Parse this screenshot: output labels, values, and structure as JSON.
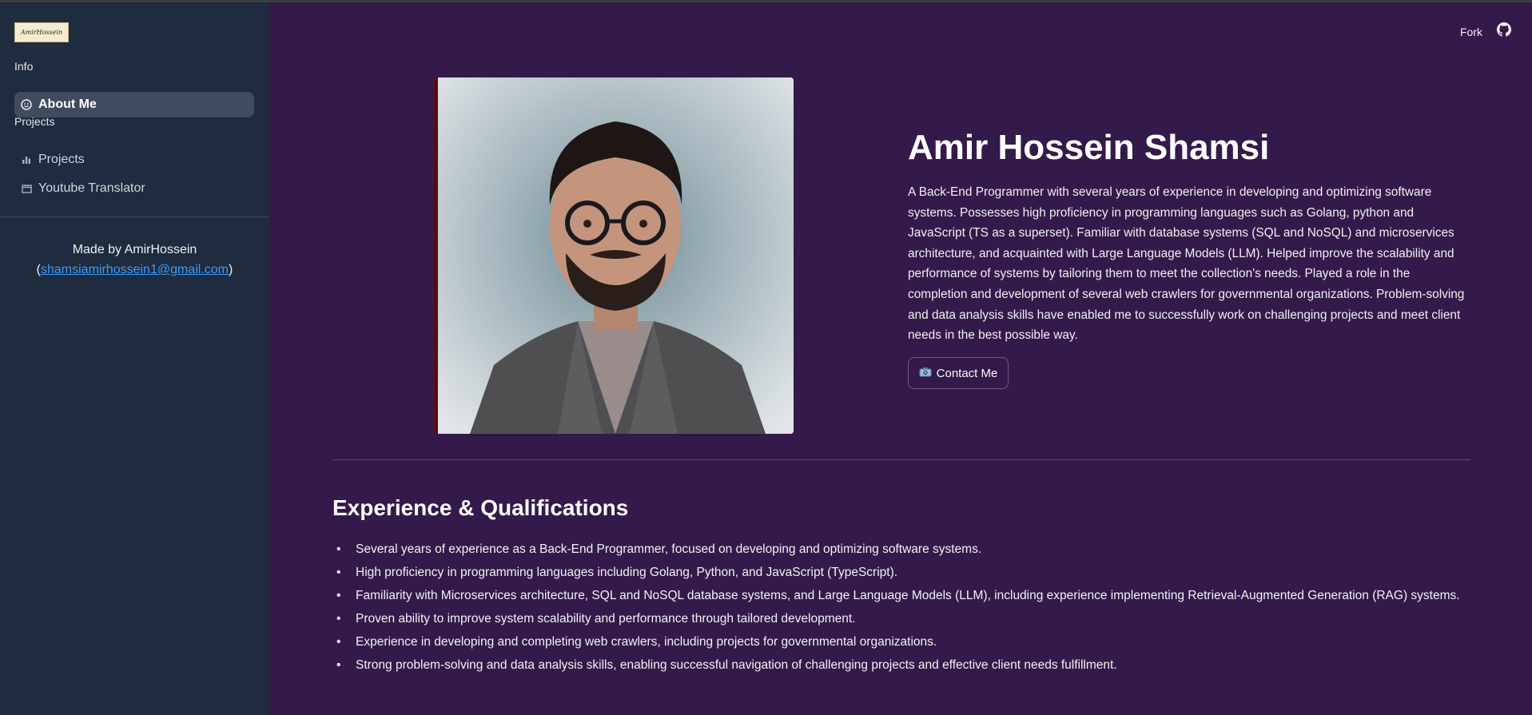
{
  "sidebar": {
    "logo_text": "AmirHossein",
    "sections": [
      {
        "title": "Info"
      },
      {
        "title": "Projects"
      }
    ],
    "items": [
      {
        "label": "About Me",
        "icon": "face-icon",
        "active": true
      },
      {
        "label": "Projects",
        "icon": "bar-chart-icon",
        "active": false
      },
      {
        "label": "Youtube Translator",
        "icon": "movie-icon",
        "active": false
      }
    ],
    "made_by": "Made by AmirHossein",
    "email": "shamsiamirhossein1@gmail.com",
    "open_paren": "(",
    "close_paren": ")"
  },
  "header": {
    "fork_label": "Fork",
    "github_icon": "github-icon"
  },
  "profile": {
    "name": "Amir Hossein Shamsi",
    "bio": "A Back-End Programmer with several years of experience in developing and optimizing software systems. Possesses high proficiency in programming languages such as Golang, python and JavaScript (TS as a superset). Familiar with database systems (SQL and NoSQL) and microservices architecture, and acquainted with Large Language Models (LLM). Helped improve the scalability and performance of systems by tailoring them to meet the collection's needs. Played a role in the completion and development of several web crawlers for governmental organizations. Problem-solving and data analysis skills have enabled me to successfully work on challenging projects and meet client needs in the best possible way.",
    "contact_label": "Contact Me",
    "contact_icon": "camera-icon"
  },
  "experience": {
    "title": "Experience & Qualifications",
    "items": [
      "Several years of experience as a Back-End Programmer, focused on developing and optimizing software systems.",
      "High proficiency in programming languages including Golang, Python, and JavaScript (TypeScript).",
      "Familiarity with Microservices architecture, SQL and NoSQL database systems, and Large Language Models (LLM), including experience implementing Retrieval-Augmented Generation (RAG) systems.",
      "Proven ability to improve system scalability and performance through tailored development.",
      "Experience in developing and completing web crawlers, including projects for governmental organizations.",
      "Strong problem-solving and data analysis skills, enabling successful navigation of challenging projects and effective client needs fulfillment."
    ]
  },
  "colors": {
    "main_bg": "#341a4a",
    "sidebar_bg": "#1f2b3e",
    "active_item_bg": "#404b60",
    "link": "#3b9cff"
  }
}
